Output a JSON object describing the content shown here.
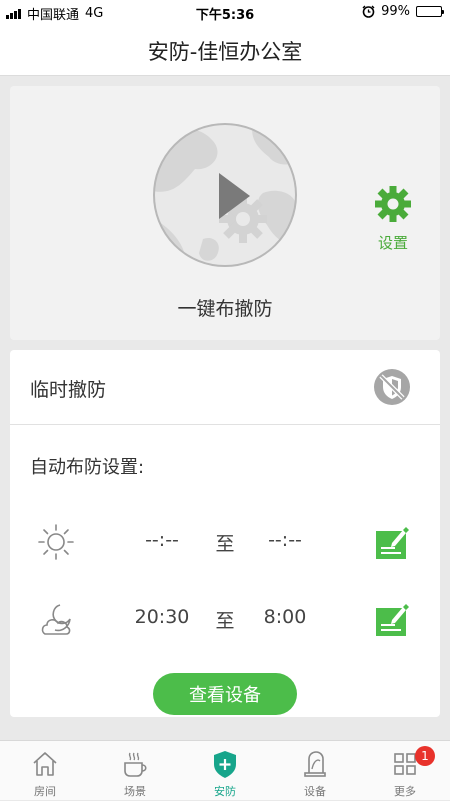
{
  "status_bar": {
    "carrier": "中国联通",
    "network": "4G",
    "time": "下午5:36",
    "battery": "99%",
    "battery_level": 0.99
  },
  "header": {
    "title": "安防-佳恒办公室"
  },
  "arm_panel": {
    "one_key_label": "一键布撤防",
    "settings_label": "设置"
  },
  "temp_disarm": {
    "label": "临时撤防"
  },
  "auto_arm": {
    "label": "自动布防设置:",
    "rows": [
      {
        "icon": "sun-icon",
        "start": "--:--",
        "to": "至",
        "end": "--:--"
      },
      {
        "icon": "moon-cloud-icon",
        "start": "20:30",
        "to": "至",
        "end": "8:00"
      }
    ],
    "view_devices": "查看设备"
  },
  "tabbar": {
    "items": [
      {
        "label": "房间",
        "icon": "home-icon"
      },
      {
        "label": "场景",
        "icon": "coffee-cup-icon"
      },
      {
        "label": "安防",
        "icon": "shield-plus-icon",
        "active": true
      },
      {
        "label": "设备",
        "icon": "device-icon"
      },
      {
        "label": "更多",
        "icon": "grid-icon",
        "badge": "1"
      }
    ]
  },
  "colors": {
    "accent_green": "#4cbd4a",
    "settings_green": "#4aab3a",
    "active_tab": "#17a58b",
    "badge_red": "#e8322b"
  }
}
